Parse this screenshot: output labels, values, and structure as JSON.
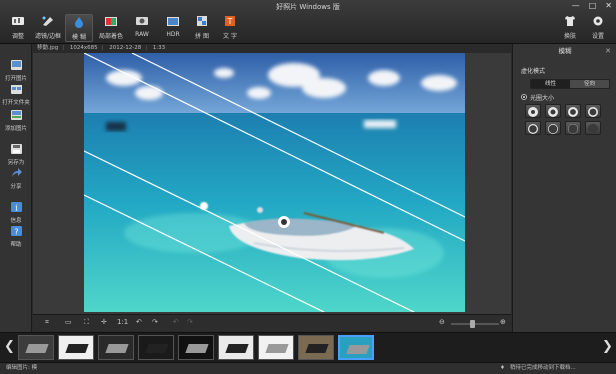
{
  "window": {
    "title": "好照片 Windows 版",
    "controls": [
      "—",
      "□",
      "✕"
    ]
  },
  "toolbar": {
    "tools": [
      {
        "label": "调整",
        "icon": "sliders-icon"
      },
      {
        "label": "滤镜/边框",
        "icon": "filter-icon"
      },
      {
        "label": "模 糊",
        "icon": "blur-drop-icon",
        "active": true
      },
      {
        "label": "局部着色",
        "icon": "selective-color-icon"
      },
      {
        "label": "RAW",
        "icon": "raw-icon"
      },
      {
        "label": "HDR",
        "icon": "hdr-icon"
      },
      {
        "label": "拼 图",
        "icon": "collage-icon"
      },
      {
        "label": "文 字",
        "icon": "text-icon"
      }
    ],
    "right": [
      {
        "label": "换肤",
        "icon": "shirt-icon"
      },
      {
        "label": "设置",
        "icon": "gear-icon"
      }
    ]
  },
  "sidebar": {
    "items": [
      {
        "label": "打开图片",
        "icon": "open-image-icon"
      },
      {
        "label": "打开文件夹",
        "icon": "open-folder-icon"
      },
      {
        "label": "添加图片",
        "icon": "add-image-icon"
      },
      {
        "label": "另存为",
        "icon": "save-as-icon"
      },
      {
        "label": "分享",
        "icon": "share-icon"
      },
      {
        "label": "信息",
        "icon": "info-icon"
      },
      {
        "label": "帮助",
        "icon": "help-icon"
      }
    ]
  },
  "info": {
    "filename": "移動.jpg",
    "dimensions": "1024x685",
    "date": "2012-12-28",
    "scale": "1:33"
  },
  "panel": {
    "title": "模糊",
    "section_mode": "虚化模式",
    "mode_options": [
      "线性",
      "径向"
    ],
    "section_aperture": "光圈大小",
    "aperture_count": 8
  },
  "canvas_tools": {
    "left": [
      "crop-icon",
      "fit-icon",
      "fit-screen-icon",
      "center-icon",
      "one-to-one-label",
      "rotate-left-icon",
      "rotate-right-icon",
      "undo-icon",
      "redo-icon"
    ],
    "one_to_one": "1:1",
    "zoom_level": 0.45
  },
  "filmstrip": {
    "count": 9,
    "selected_index": 8
  },
  "status": {
    "left": "编辑图片: 模",
    "right": "稍待已完成移动到下载档..."
  },
  "colors": {
    "accent": "#4aa0ff",
    "selected_thumb_border": "#4aa0ff"
  }
}
